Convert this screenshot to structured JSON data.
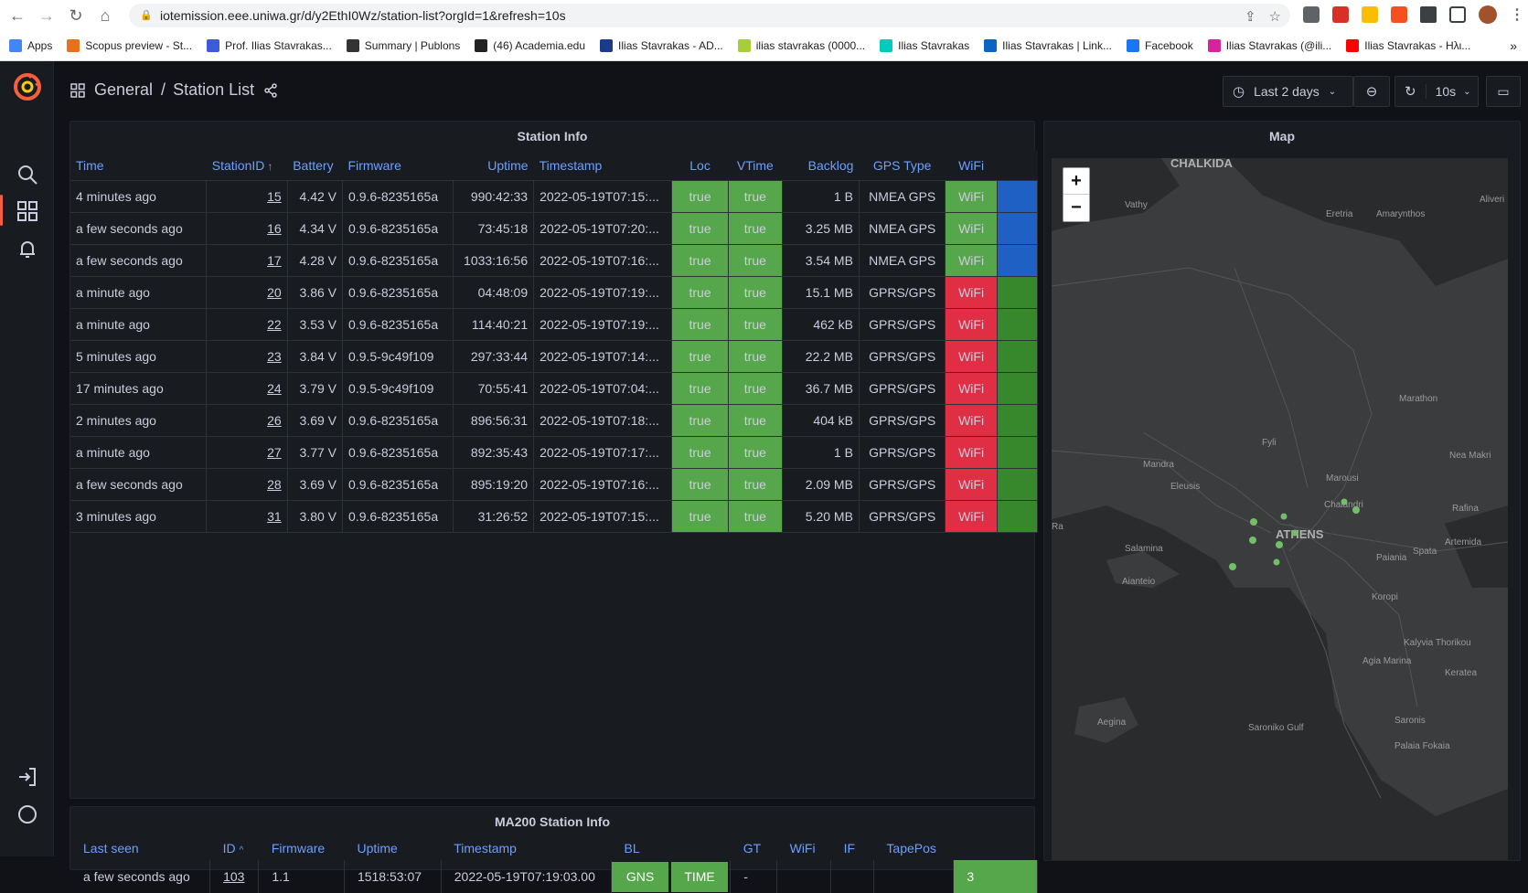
{
  "browser": {
    "url": "iotemission.eee.uniwa.gr/d/y2EthI0Wz/station-list?orgId=1&refresh=10s",
    "bookmarks": [
      {
        "label": "Apps",
        "color": "#4285f4"
      },
      {
        "label": "Scopus preview - St...",
        "color": "#e9711c"
      },
      {
        "label": "Prof. Ilias Stavrakas...",
        "color": "#3b5bdb"
      },
      {
        "label": "Summary | Publons",
        "color": "#333333"
      },
      {
        "label": "(46) Academia.edu",
        "color": "#222222"
      },
      {
        "label": "Ilias Stavrakas - AD...",
        "color": "#1a3a8a"
      },
      {
        "label": "ilias stavrakas (0000...",
        "color": "#a6ce39"
      },
      {
        "label": "Ilias Stavrakas",
        "color": "#00ccbb"
      },
      {
        "label": "Ilias Stavrakas | Link...",
        "color": "#0a66c2"
      },
      {
        "label": "Facebook",
        "color": "#1877f2"
      },
      {
        "label": "Ilias Stavrakas (@ili...",
        "color": "#d6249f"
      },
      {
        "label": "Ilias Stavrakas - Ηλι...",
        "color": "#ff0000"
      }
    ],
    "more_bookmarks": "»"
  },
  "dashboard": {
    "folder": "General",
    "separator": "/",
    "title": "Station List",
    "time_range": "Last 2 days",
    "refresh_interval": "10s"
  },
  "station_info": {
    "title": "Station Info",
    "columns": [
      "Time",
      "StationID",
      "Battery",
      "Firmware",
      "Uptime",
      "Timestamp",
      "Loc",
      "VTime",
      "Backlog",
      "GPS Type",
      "WiFi"
    ],
    "sort_indicator": "↑",
    "rows": [
      {
        "time": "4 minutes ago",
        "id": "15",
        "battery": "4.42 V",
        "firmware": "0.9.6-8235165a",
        "uptime": "990:42:33",
        "timestamp": "2022-05-19T07:15:...",
        "loc": "true",
        "vtime": "true",
        "backlog": "1 B",
        "gps": "NMEA GPS",
        "wifi": "WiFi",
        "wifi_ok": true,
        "status": "blue"
      },
      {
        "time": "a few seconds ago",
        "id": "16",
        "battery": "4.34 V",
        "firmware": "0.9.6-8235165a",
        "uptime": "73:45:18",
        "timestamp": "2022-05-19T07:20:...",
        "loc": "true",
        "vtime": "true",
        "backlog": "3.25 MB",
        "gps": "NMEA GPS",
        "wifi": "WiFi",
        "wifi_ok": true,
        "status": "blue"
      },
      {
        "time": "a few seconds ago",
        "id": "17",
        "battery": "4.28 V",
        "firmware": "0.9.6-8235165a",
        "uptime": "1033:16:56",
        "timestamp": "2022-05-19T07:16:...",
        "loc": "true",
        "vtime": "true",
        "backlog": "3.54 MB",
        "gps": "NMEA GPS",
        "wifi": "WiFi",
        "wifi_ok": true,
        "status": "blue"
      },
      {
        "time": "a minute ago",
        "id": "20",
        "battery": "3.86 V",
        "firmware": "0.9.6-8235165a",
        "uptime": "04:48:09",
        "timestamp": "2022-05-19T07:19:...",
        "loc": "true",
        "vtime": "true",
        "backlog": "15.1 MB",
        "gps": "GPRS/GPS",
        "wifi": "WiFi",
        "wifi_ok": false,
        "status": "green"
      },
      {
        "time": "a minute ago",
        "id": "22",
        "battery": "3.53 V",
        "firmware": "0.9.6-8235165a",
        "uptime": "114:40:21",
        "timestamp": "2022-05-19T07:19:...",
        "loc": "true",
        "vtime": "true",
        "backlog": "462 kB",
        "gps": "GPRS/GPS",
        "wifi": "WiFi",
        "wifi_ok": false,
        "status": "green"
      },
      {
        "time": "5 minutes ago",
        "id": "23",
        "battery": "3.84 V",
        "firmware": "0.9.5-9c49f109",
        "uptime": "297:33:44",
        "timestamp": "2022-05-19T07:14:...",
        "loc": "true",
        "vtime": "true",
        "backlog": "22.2 MB",
        "gps": "GPRS/GPS",
        "wifi": "WiFi",
        "wifi_ok": false,
        "status": "green"
      },
      {
        "time": "17 minutes ago",
        "id": "24",
        "battery": "3.79 V",
        "firmware": "0.9.5-9c49f109",
        "uptime": "70:55:41",
        "timestamp": "2022-05-19T07:04:...",
        "loc": "true",
        "vtime": "true",
        "backlog": "36.7 MB",
        "gps": "GPRS/GPS",
        "wifi": "WiFi",
        "wifi_ok": false,
        "status": "green"
      },
      {
        "time": "2 minutes ago",
        "id": "26",
        "battery": "3.69 V",
        "firmware": "0.9.6-8235165a",
        "uptime": "896:56:31",
        "timestamp": "2022-05-19T07:18:...",
        "loc": "true",
        "vtime": "true",
        "backlog": "404 kB",
        "gps": "GPRS/GPS",
        "wifi": "WiFi",
        "wifi_ok": false,
        "status": "green"
      },
      {
        "time": "a minute ago",
        "id": "27",
        "battery": "3.77 V",
        "firmware": "0.9.6-8235165a",
        "uptime": "892:35:43",
        "timestamp": "2022-05-19T07:17:...",
        "loc": "true",
        "vtime": "true",
        "backlog": "1 B",
        "gps": "GPRS/GPS",
        "wifi": "WiFi",
        "wifi_ok": false,
        "status": "green"
      },
      {
        "time": "a few seconds ago",
        "id": "28",
        "battery": "3.69 V",
        "firmware": "0.9.6-8235165a",
        "uptime": "895:19:20",
        "timestamp": "2022-05-19T07:16:...",
        "loc": "true",
        "vtime": "true",
        "backlog": "2.09 MB",
        "gps": "GPRS/GPS",
        "wifi": "WiFi",
        "wifi_ok": false,
        "status": "green"
      },
      {
        "time": "3 minutes ago",
        "id": "31",
        "battery": "3.80 V",
        "firmware": "0.9.6-8235165a",
        "uptime": "31:26:52",
        "timestamp": "2022-05-19T07:15:...",
        "loc": "true",
        "vtime": "true",
        "backlog": "5.20 MB",
        "gps": "GPRS/GPS",
        "wifi": "WiFi",
        "wifi_ok": false,
        "status": "green"
      }
    ]
  },
  "map": {
    "title": "Map",
    "zoom_in": "+",
    "zoom_out": "−",
    "labels": [
      "CHALKIDA",
      "Vathy",
      "Eretria",
      "Amarynthos",
      "Aliveri",
      "Marathon",
      "Nea Makri",
      "Fyli",
      "Mandra",
      "Eleusis",
      "Marousi",
      "Chalandri",
      "Rafina",
      "ATHENS",
      "Artemida",
      "Salamina",
      "PIRAEUS",
      "Paiania",
      "Spata",
      "Aianteio",
      "Koropi",
      "Kalyvia Thorikou",
      "Agia Marina",
      "Keratea",
      "Aegina",
      "Saroniko Gulf",
      "Saronis",
      "Palaia Fokaia",
      "Elefsina",
      "Ra"
    ]
  },
  "ma200": {
    "title": "MA200 Station Info",
    "columns": [
      "Last seen",
      "ID",
      "Firmware",
      "Uptime",
      "Timestamp",
      "BL",
      "GT",
      "WiFi",
      "IF",
      "TapePos"
    ],
    "sort_indicator": "^",
    "row": {
      "last_seen": "a few seconds ago",
      "id": "103",
      "firmware": "1.1",
      "uptime": "1518:53:07",
      "timestamp": "2022-05-19T07:19:03.00",
      "gns": "GNS",
      "time": "TIME",
      "bl": "-",
      "gt": "",
      "wifi": "",
      "if": "",
      "tapepos": "3"
    }
  },
  "colors": {
    "green": "#56a64b",
    "red": "#e02f44",
    "blue": "#1f60c4",
    "dark_green": "#37872d",
    "link": "#6e9fff",
    "grafana_orange": "#f55f3e"
  }
}
